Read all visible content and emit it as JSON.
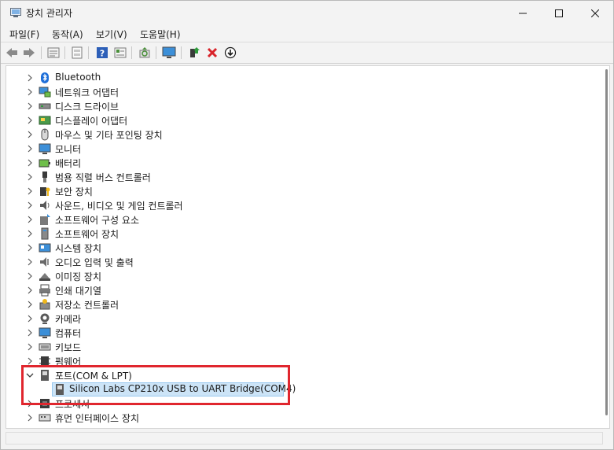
{
  "window": {
    "title": "장치 관리자"
  },
  "menu": {
    "items": [
      "파일(F)",
      "동작(A)",
      "보기(V)",
      "도움말(H)"
    ]
  },
  "toolbar": {
    "buttons": [
      "back-icon",
      "forward-icon",
      "properties-icon",
      "show-hidden-icon",
      "help-icon",
      "update-driver-icon",
      "scan-hardware-icon",
      "monitor-icon",
      "enable-device-icon",
      "uninstall-icon",
      "disable-icon"
    ]
  },
  "tree": {
    "categories": [
      {
        "label": "Bluetooth",
        "icon": "bluetooth-icon",
        "expanded": false
      },
      {
        "label": "네트워크 어댑터",
        "icon": "network-adapter-icon",
        "expanded": false
      },
      {
        "label": "디스크 드라이브",
        "icon": "disk-drive-icon",
        "expanded": false
      },
      {
        "label": "디스플레이 어댑터",
        "icon": "display-adapter-icon",
        "expanded": false
      },
      {
        "label": "마우스 및 기타 포인팅 장치",
        "icon": "mouse-icon",
        "expanded": false
      },
      {
        "label": "모니터",
        "icon": "monitor-icon",
        "expanded": false
      },
      {
        "label": "배터리",
        "icon": "battery-icon",
        "expanded": false
      },
      {
        "label": "범용 직렬 버스 컨트롤러",
        "icon": "usb-controller-icon",
        "expanded": false
      },
      {
        "label": "보안 장치",
        "icon": "security-device-icon",
        "expanded": false
      },
      {
        "label": "사운드, 비디오 및 게임 컨트롤러",
        "icon": "sound-icon",
        "expanded": false
      },
      {
        "label": "소프트웨어 구성 요소",
        "icon": "software-component-icon",
        "expanded": false
      },
      {
        "label": "소프트웨어 장치",
        "icon": "software-device-icon",
        "expanded": false
      },
      {
        "label": "시스템 장치",
        "icon": "system-device-icon",
        "expanded": false
      },
      {
        "label": "오디오 입력 및 출력",
        "icon": "audio-io-icon",
        "expanded": false
      },
      {
        "label": "이미징 장치",
        "icon": "imaging-device-icon",
        "expanded": false
      },
      {
        "label": "인쇄 대기열",
        "icon": "print-queue-icon",
        "expanded": false
      },
      {
        "label": "저장소 컨트롤러",
        "icon": "storage-controller-icon",
        "expanded": false
      },
      {
        "label": "카메라",
        "icon": "camera-icon",
        "expanded": false
      },
      {
        "label": "컴퓨터",
        "icon": "computer-icon",
        "expanded": false
      },
      {
        "label": "키보드",
        "icon": "keyboard-icon",
        "expanded": false
      },
      {
        "label": "펌웨어",
        "icon": "firmware-icon",
        "expanded": false
      },
      {
        "label": "포트(COM & LPT)",
        "icon": "port-icon",
        "expanded": true
      },
      {
        "label": "프로세서",
        "icon": "processor-icon",
        "expanded": false
      },
      {
        "label": "휴먼 인터페이스 장치",
        "icon": "hid-icon",
        "expanded": false
      }
    ],
    "ports_children": [
      {
        "label": "Silicon Labs CP210x USB to UART Bridge(COM4)",
        "selected": true
      }
    ]
  },
  "colors": {
    "highlight": "#e0262e",
    "selection": "#cce4f7",
    "uninstall_red": "#d9242b",
    "accent_blue": "#1e6fd9"
  }
}
